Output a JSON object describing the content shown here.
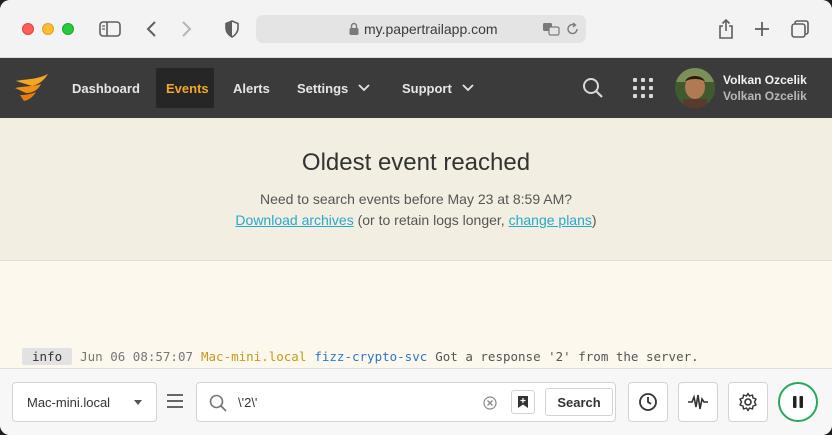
{
  "browser": {
    "url": "my.papertrailapp.com"
  },
  "nav": {
    "items": [
      {
        "label": "Dashboard"
      },
      {
        "label": "Events"
      },
      {
        "label": "Alerts"
      },
      {
        "label": "Settings"
      },
      {
        "label": "Support"
      }
    ],
    "user": {
      "name": "Volkan Ozcelik",
      "account": "Volkan Ozcelik"
    }
  },
  "banner": {
    "title": "Oldest event reached",
    "line1": "Need to search events before May 23 at 8:59 AM?",
    "download_link": "Download archives",
    "middle_text": " (or to retain logs longer, ",
    "change_link": "change plans",
    "end_text": ")"
  },
  "log": {
    "level": "info",
    "timestamp": "Jun 06 08:57:07",
    "host": "Mac-mini.local",
    "program": "fizz-crypto-svc",
    "message": "Got a response '2' from the server."
  },
  "bottom": {
    "system": "Mac-mini.local",
    "query": "\\'2\\'",
    "search_label": "Search"
  },
  "colors": {
    "accent": "#f5a623",
    "nav_bg": "#3b3b3b",
    "banner_bg": "#f2eee1",
    "link": "#27a9c9",
    "live_green": "#27a85a"
  }
}
